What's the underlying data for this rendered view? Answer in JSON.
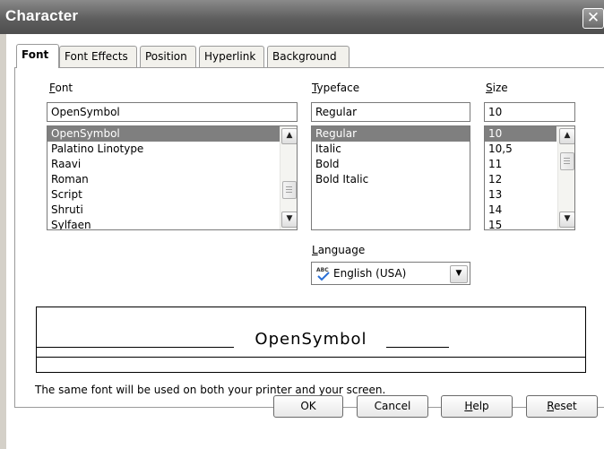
{
  "window": {
    "title": "Character",
    "close_glyph": "✕"
  },
  "tabs": [
    {
      "label": "Font",
      "active": true
    },
    {
      "label": "Font Effects",
      "active": false
    },
    {
      "label": "Position",
      "active": false
    },
    {
      "label": "Hyperlink",
      "active": false
    },
    {
      "label": "Background",
      "active": false
    }
  ],
  "font": {
    "label_accel": "F",
    "label_rest": "ont",
    "value": "OpenSymbol",
    "items": [
      "OpenSymbol",
      "Palatino Linotype",
      "Raavi",
      "Roman",
      "Script",
      "Shruti",
      "Sylfaen"
    ],
    "selected": "OpenSymbol"
  },
  "typeface": {
    "label_accel": "T",
    "label_rest": "ypeface",
    "value": "Regular",
    "items": [
      "Regular",
      "Italic",
      "Bold",
      "Bold Italic"
    ],
    "selected": "Regular"
  },
  "size": {
    "label_accel": "S",
    "label_rest": "ize",
    "value": "10",
    "items": [
      "10",
      "10,5",
      "11",
      "12",
      "13",
      "14",
      "15"
    ],
    "selected": "10"
  },
  "language": {
    "label_accel": "L",
    "label_rest": "anguage",
    "value": "English (USA)",
    "icon_text": "ABC",
    "icon": "spellcheck-icon"
  },
  "preview": {
    "text": "OpenSymbol"
  },
  "info_text": "The same font will be used on both your printer and your screen.",
  "buttons": {
    "ok": "OK",
    "cancel": "Cancel",
    "help_accel": "H",
    "help_rest": "elp",
    "reset_accel": "R",
    "reset_rest": "eset"
  },
  "colors": {
    "titlebar": "#5e5e5e",
    "selection": "#7f7f7f"
  }
}
